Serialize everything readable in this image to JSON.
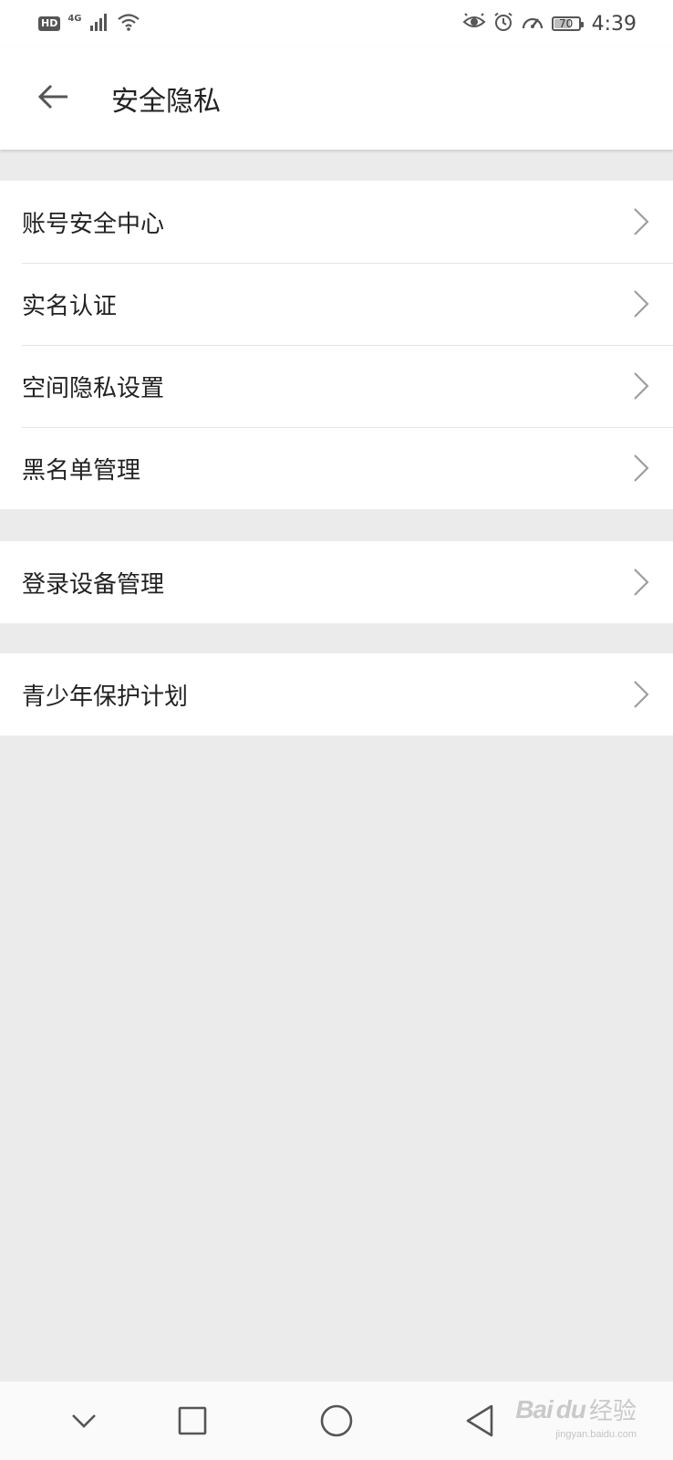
{
  "status_bar": {
    "hd_label": "HD",
    "network_label": "4G",
    "battery_level": 70,
    "battery_text": "70",
    "time": "4:39",
    "icons": [
      "signal-icon",
      "wifi-icon",
      "eye-icon",
      "alarm-icon",
      "speed-icon",
      "battery-icon"
    ]
  },
  "header": {
    "title": "安全隐私",
    "back_icon": "arrow-left-icon"
  },
  "groups": [
    {
      "items": [
        {
          "label": "账号安全中心"
        },
        {
          "label": "实名认证"
        },
        {
          "label": "空间隐私设置"
        },
        {
          "label": "黑名单管理"
        }
      ]
    },
    {
      "items": [
        {
          "label": "登录设备管理"
        }
      ]
    },
    {
      "items": [
        {
          "label": "青少年保护计划"
        }
      ]
    }
  ],
  "nav_bar": {
    "icons": [
      "chevron-down-icon",
      "square-icon",
      "circle-icon",
      "triangle-back-icon"
    ]
  },
  "watermark": {
    "brand": "Bai",
    "brand_du": "du",
    "brand_cn": "经验",
    "url": "jingyan.baidu.com"
  },
  "colors": {
    "background": "#ebebeb",
    "surface": "#ffffff",
    "divider": "#e4e4e4",
    "chevron": "#9e9e9e",
    "text": "#222222"
  }
}
